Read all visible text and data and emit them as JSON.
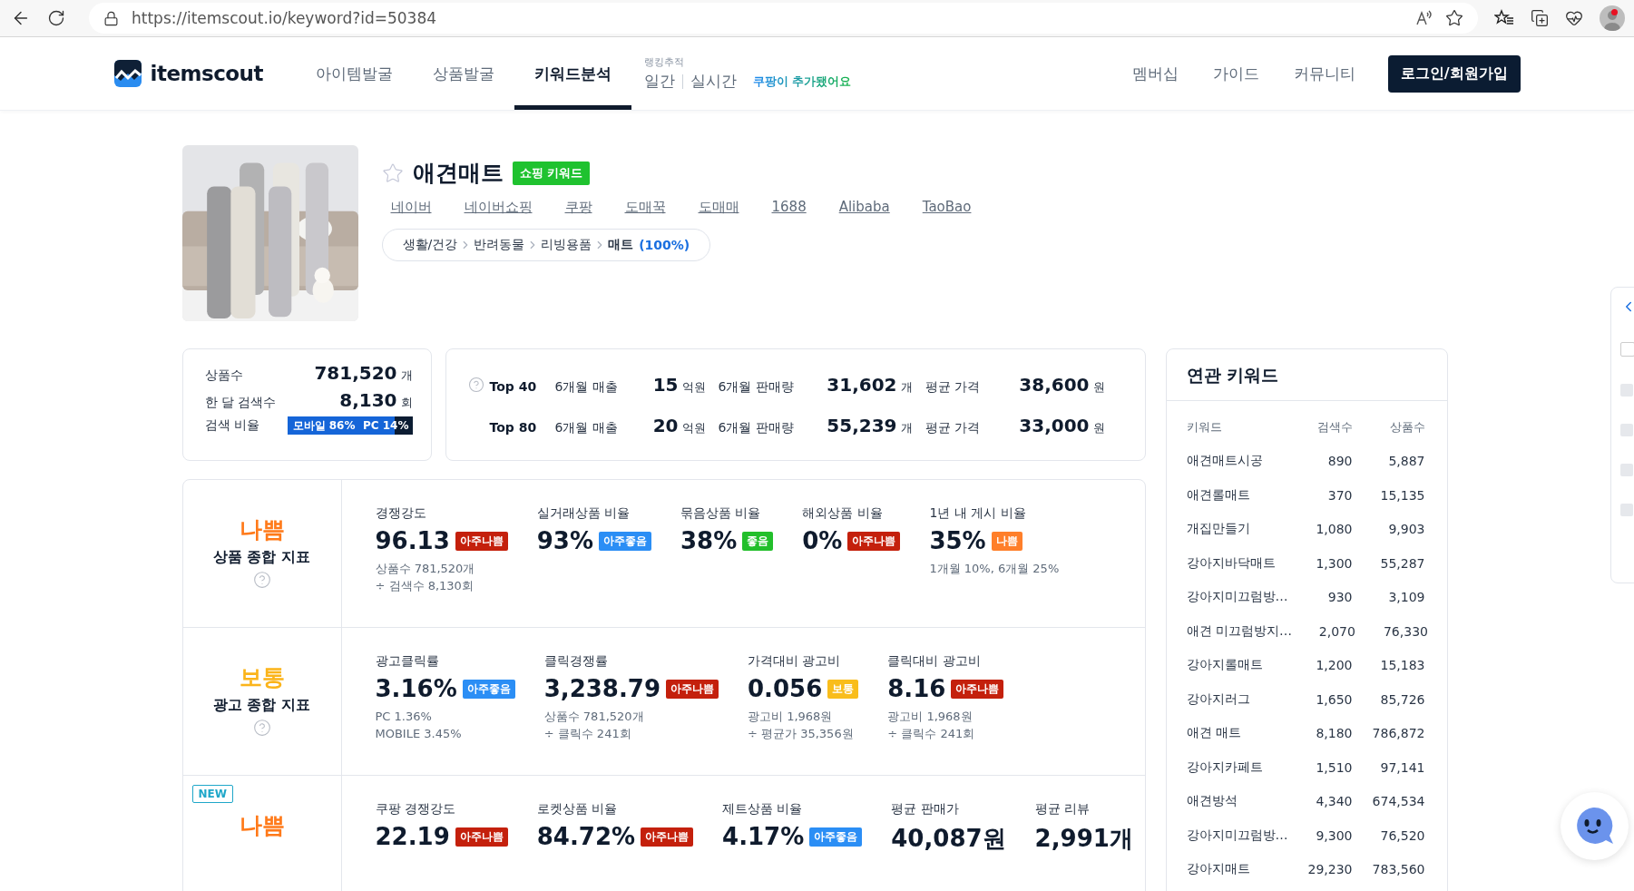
{
  "browser": {
    "url": "https://itemscout.io/keyword?id=50384",
    "notification": true
  },
  "nav": {
    "logo": "itemscout",
    "items": [
      {
        "label": "아이템발굴",
        "selected": false
      },
      {
        "label": "상품발굴",
        "selected": false
      },
      {
        "label": "키워드분석",
        "selected": true
      }
    ],
    "ranking": {
      "label": "랭킹추적",
      "links": [
        "일간",
        "실시간"
      ],
      "notice": "쿠팡이 추가됐어요"
    },
    "links": [
      "멤버십",
      "가이드",
      "커뮤니티"
    ],
    "login": "로그인/회원가입"
  },
  "keyword": {
    "title": "애견매트",
    "starred": false,
    "badge": "쇼핑 키워드",
    "links": [
      "네이버",
      "네이버쇼핑",
      "쿠팡",
      "도매꾹",
      "도매매",
      "1688",
      "Alibaba",
      "TaoBao"
    ],
    "category": [
      "생활/건강",
      "반려동물",
      "리빙용품",
      "매트"
    ],
    "category_share": "(100%)"
  },
  "summary": {
    "rows": [
      {
        "label": "상품수",
        "value": "781,520",
        "unit": "개"
      },
      {
        "label": "한 달 검색수",
        "value": "8,130",
        "unit": "회"
      }
    ],
    "ratio": {
      "label": "검색 비율",
      "mobile": "모바일 86%",
      "pc": "PC 14%",
      "level": 0.86
    }
  },
  "top": [
    {
      "label": "Top 40",
      "help": true,
      "sales_label": "6개월 매출",
      "sales": "15",
      "sales_unit": "억원",
      "volume_label": "6개월 판매량",
      "volume": "31,602",
      "volume_unit": "개",
      "price_label": "평균 가격",
      "price": "38,600",
      "price_unit": "원"
    },
    {
      "label": "Top 80",
      "help": false,
      "sales_label": "6개월 매출",
      "sales": "20",
      "sales_unit": "억원",
      "volume_label": "6개월 판매량",
      "volume": "55,239",
      "volume_unit": "개",
      "price_label": "평균 가격",
      "price": "33,000",
      "price_unit": "원"
    }
  ],
  "indicators": [
    {
      "grade": "나쁨",
      "color": "#ff7a1a",
      "name": "상품 종합 지표",
      "new": false,
      "metrics": [
        {
          "label": "경쟁강도",
          "value": "96.13",
          "rating": "아주나쁨",
          "color": "#c4200c",
          "notes": [
            "상품수 781,520개",
            "÷ 검색수 8,130회"
          ]
        },
        {
          "label": "실거래상품 비율",
          "value": "93%",
          "rating": "아주좋음",
          "color": "#2b8ef5"
        },
        {
          "label": "묶음상품 비율",
          "value": "38%",
          "rating": "좋음",
          "color": "#22bf2b"
        },
        {
          "label": "해외상품 비율",
          "value": "0%",
          "rating": "아주나쁨",
          "color": "#c4200c"
        },
        {
          "label": "1년 내 게시 비율",
          "value": "35%",
          "rating": "나쁨",
          "color": "#ff7f2a",
          "notes": [
            "1개월 10%, 6개월 25%"
          ]
        }
      ]
    },
    {
      "grade": "보통",
      "color": "#fbb41a",
      "name": "광고 종합 지표",
      "new": false,
      "metrics": [
        {
          "label": "광고클릭률",
          "value": "3.16%",
          "rating": "아주좋음",
          "color": "#2b8ef5",
          "notes": [
            "PC 1.36%",
            "MOBILE 3.45%"
          ]
        },
        {
          "label": "클릭경쟁률",
          "value": "3,238.79",
          "rating": "아주나쁨",
          "color": "#c4200c",
          "notes": [
            "상품수 781,520개",
            "÷ 클릭수 241회"
          ]
        },
        {
          "label": "가격대비 광고비",
          "value": "0.056",
          "rating": "보통",
          "color": "#f9bd1b",
          "notes": [
            "광고비 1,968원",
            "÷ 평균가 35,356원"
          ]
        },
        {
          "label": "클릭대비 광고비",
          "value": "8.16",
          "rating": "아주나쁨",
          "color": "#c4200c",
          "notes": [
            "광고비 1,968원",
            "÷ 클릭수 241회"
          ]
        }
      ]
    },
    {
      "grade": "나쁨",
      "color": "#ff7a1a",
      "new_label": "NEW",
      "new": true,
      "metrics": [
        {
          "label": "쿠팡 경쟁강도",
          "value": "22.19",
          "rating": "아주나쁨",
          "color": "#c4200c"
        },
        {
          "label": "로켓상품 비율",
          "value": "84.72%",
          "rating": "아주나쁨",
          "color": "#c4200c"
        },
        {
          "label": "제트상품 비율",
          "value": "4.17%",
          "rating": "아주좋음",
          "color": "#2b8ef5"
        },
        {
          "label": "평균 판매가",
          "value": "40,087원"
        },
        {
          "label": "평균 리뷰",
          "value": "2,991개"
        }
      ]
    }
  ],
  "related": {
    "title": "연관 키워드",
    "columns": [
      "키워드",
      "검색수",
      "상품수"
    ],
    "rows": [
      [
        "애견매트시공",
        "890",
        "5,887"
      ],
      [
        "애견롤매트",
        "370",
        "15,135"
      ],
      [
        "개집만들기",
        "1,080",
        "9,903"
      ],
      [
        "강아지바닥매트",
        "1,300",
        "55,287"
      ],
      [
        "강아지미끄럼방…",
        "930",
        "3,109"
      ],
      [
        "애견 미끄럼방지…",
        "2,070",
        "76,330"
      ],
      [
        "강아지롤매트",
        "1,200",
        "15,183"
      ],
      [
        "강아지러그",
        "1,650",
        "85,726"
      ],
      [
        "애견 매트",
        "8,180",
        "786,872"
      ],
      [
        "강아지카페트",
        "1,510",
        "97,141"
      ],
      [
        "애견방석",
        "4,340",
        "674,534"
      ],
      [
        "강아지미끄럼방…",
        "9,300",
        "76,520"
      ],
      [
        "강아지매트",
        "29,230",
        "783,560"
      ]
    ]
  }
}
